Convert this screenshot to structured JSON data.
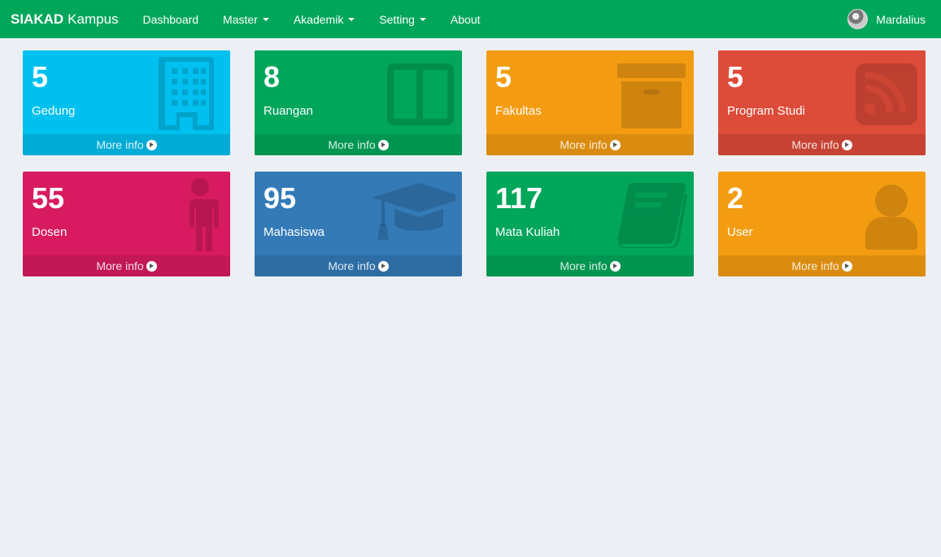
{
  "navbar": {
    "brand_bold": "SIAKAD",
    "brand_rest": "Kampus",
    "items": [
      {
        "label": "Dashboard"
      },
      {
        "label": "Master"
      },
      {
        "label": "Akademik"
      },
      {
        "label": "Setting"
      },
      {
        "label": "About"
      }
    ],
    "user_name": "Mardalius"
  },
  "boxes": [
    {
      "value": "5",
      "label": "Gedung",
      "footer": "More info",
      "icon": "building-icon",
      "color": "#00c0ef"
    },
    {
      "value": "8",
      "label": "Ruangan",
      "footer": "More info",
      "icon": "columns-icon",
      "color": "#00a65a"
    },
    {
      "value": "5",
      "label": "Fakultas",
      "footer": "More info",
      "icon": "archive-icon",
      "color": "#f39c12"
    },
    {
      "value": "5",
      "label": "Program Studi",
      "footer": "More info",
      "icon": "rss-icon",
      "color": "#dd4b39"
    },
    {
      "value": "55",
      "label": "Dosen",
      "footer": "More info",
      "icon": "male-icon",
      "color": "#d81b60"
    },
    {
      "value": "95",
      "label": "Mahasiswa",
      "footer": "More info",
      "icon": "graduation-cap-icon",
      "color": "#337ab7"
    },
    {
      "value": "117",
      "label": "Mata Kuliah",
      "footer": "More info",
      "icon": "book-icon",
      "color": "#00a65a"
    },
    {
      "value": "2",
      "label": "User",
      "footer": "More info",
      "icon": "user-icon",
      "color": "#f39c12"
    }
  ]
}
